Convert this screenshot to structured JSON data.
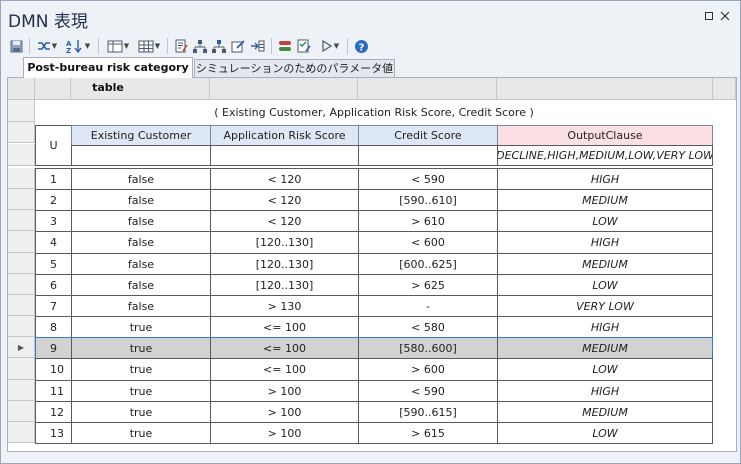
{
  "window": {
    "title": "DMN 表現"
  },
  "toolbar": {
    "icons": [
      "save-icon",
      "shuffle-icon",
      "sort-icon",
      "columns-icon",
      "grid-icon",
      "document-edit-icon",
      "hierarchy-icon",
      "hierarchy-alt-icon",
      "edit-icon",
      "insert-column-icon",
      "toggle-icon",
      "checklist-icon",
      "play-icon",
      "help-icon"
    ]
  },
  "tabs": [
    {
      "label": "Post-bureau risk category table",
      "active": true
    },
    {
      "label": "シミュレーションのためのパラメータ値",
      "active": false
    }
  ],
  "table": {
    "hit_policy": "U",
    "input_expression": "( Existing Customer, Application Risk Score, Credit Score )",
    "inputs": [
      {
        "label": "Existing Customer",
        "allowed": ""
      },
      {
        "label": "Application Risk Score",
        "allowed": ""
      },
      {
        "label": "Credit Score",
        "allowed": ""
      }
    ],
    "output": {
      "label": "OutputClause",
      "allowed": "DECLINE,HIGH,MEDIUM,LOW,VERY LOW"
    },
    "rules": [
      {
        "n": "1",
        "c1": "false",
        "c2": "< 120",
        "c3": "< 590",
        "out": "HIGH"
      },
      {
        "n": "2",
        "c1": "false",
        "c2": "< 120",
        "c3": "[590..610]",
        "out": "MEDIUM"
      },
      {
        "n": "3",
        "c1": "false",
        "c2": "< 120",
        "c3": "> 610",
        "out": "LOW"
      },
      {
        "n": "4",
        "c1": "false",
        "c2": "[120..130]",
        "c3": "< 600",
        "out": "HIGH"
      },
      {
        "n": "5",
        "c1": "false",
        "c2": "[120..130]",
        "c3": "[600..625]",
        "out": "MEDIUM"
      },
      {
        "n": "6",
        "c1": "false",
        "c2": "[120..130]",
        "c3": "> 625",
        "out": "LOW"
      },
      {
        "n": "7",
        "c1": "false",
        "c2": "> 130",
        "c3": "-",
        "out": "VERY LOW"
      },
      {
        "n": "8",
        "c1": "true",
        "c2": "<= 100",
        "c3": "< 580",
        "out": "HIGH"
      },
      {
        "n": "9",
        "c1": "true",
        "c2": "<= 100",
        "c3": "[580..600]",
        "out": "MEDIUM",
        "selected": true
      },
      {
        "n": "10",
        "c1": "true",
        "c2": "<= 100",
        "c3": "> 600",
        "out": "LOW"
      },
      {
        "n": "11",
        "c1": "true",
        "c2": "> 100",
        "c3": "< 590",
        "out": "HIGH"
      },
      {
        "n": "12",
        "c1": "true",
        "c2": "> 100",
        "c3": "[590..615]",
        "out": "MEDIUM"
      },
      {
        "n": "13",
        "c1": "true",
        "c2": "> 100",
        "c3": "> 615",
        "out": "LOW"
      }
    ]
  },
  "colors": {
    "input_header_bg": "#dde7f6",
    "output_header_bg": "#fae0e2",
    "selected_row_bg": "#d2d2d2"
  }
}
